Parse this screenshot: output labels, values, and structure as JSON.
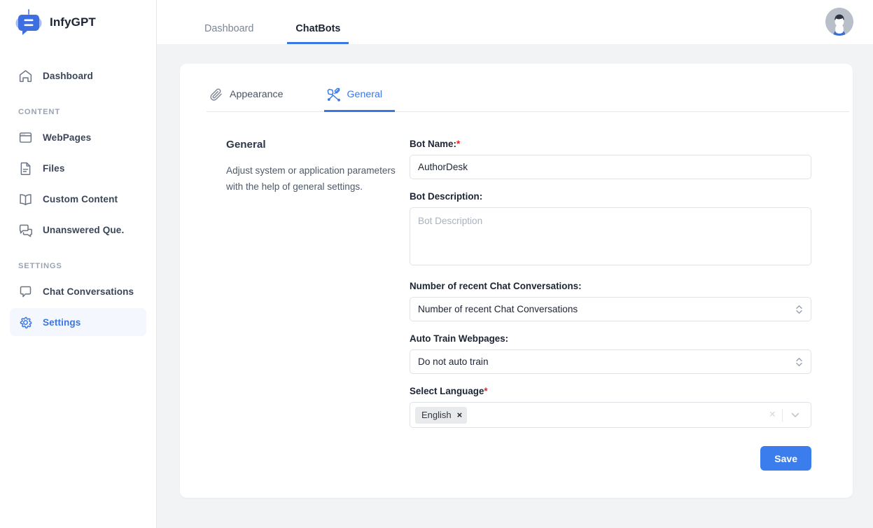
{
  "brand": {
    "name": "InfyGPT",
    "logo_icon": "chatbot-logo-icon",
    "accent": "#3b77e3"
  },
  "sidebar": {
    "top_items": [
      {
        "label": "Dashboard",
        "icon": "home-icon",
        "active": false
      }
    ],
    "sections": [
      {
        "title": "CONTENT",
        "items": [
          {
            "label": "WebPages",
            "icon": "browser-window-icon",
            "active": false
          },
          {
            "label": "Files",
            "icon": "document-icon",
            "active": false
          },
          {
            "label": "Custom Content",
            "icon": "open-book-icon",
            "active": false
          },
          {
            "label": "Unanswered Que.",
            "icon": "chat-bubbles-icon",
            "active": false
          }
        ]
      },
      {
        "title": "SETTINGS",
        "items": [
          {
            "label": "Chat Conversations",
            "icon": "chat-bubble-icon",
            "active": false
          },
          {
            "label": "Settings",
            "icon": "gear-icon",
            "active": true
          }
        ]
      }
    ]
  },
  "topbar": {
    "tabs": [
      {
        "label": "Dashboard",
        "active": false
      },
      {
        "label": "ChatBots",
        "active": true
      }
    ],
    "avatar_icon": "user-avatar"
  },
  "card": {
    "tabs": [
      {
        "label": "Appearance",
        "icon": "paperclip-icon",
        "active": false
      },
      {
        "label": "General",
        "icon": "tools-icon",
        "active": true
      }
    ],
    "section": {
      "title": "General",
      "description": "Adjust system or application parameters with the help of general settings."
    },
    "form": {
      "bot_name": {
        "label": "Bot Name:",
        "required": true,
        "value": "AuthorDesk",
        "placeholder": "Bot Name"
      },
      "bot_description": {
        "label": "Bot Description:",
        "required": false,
        "value": "",
        "placeholder": "Bot Description"
      },
      "recent_conversations": {
        "label": "Number of recent Chat Conversations:",
        "required": false,
        "value": "Number of recent Chat Conversations"
      },
      "auto_train": {
        "label": "Auto Train Webpages:",
        "required": false,
        "value": "Do not auto train"
      },
      "language": {
        "label": "Select Language",
        "required": true,
        "selected": [
          "English"
        ],
        "chip_remove": "×",
        "clear_all": "×"
      }
    },
    "save_button": "Save"
  }
}
